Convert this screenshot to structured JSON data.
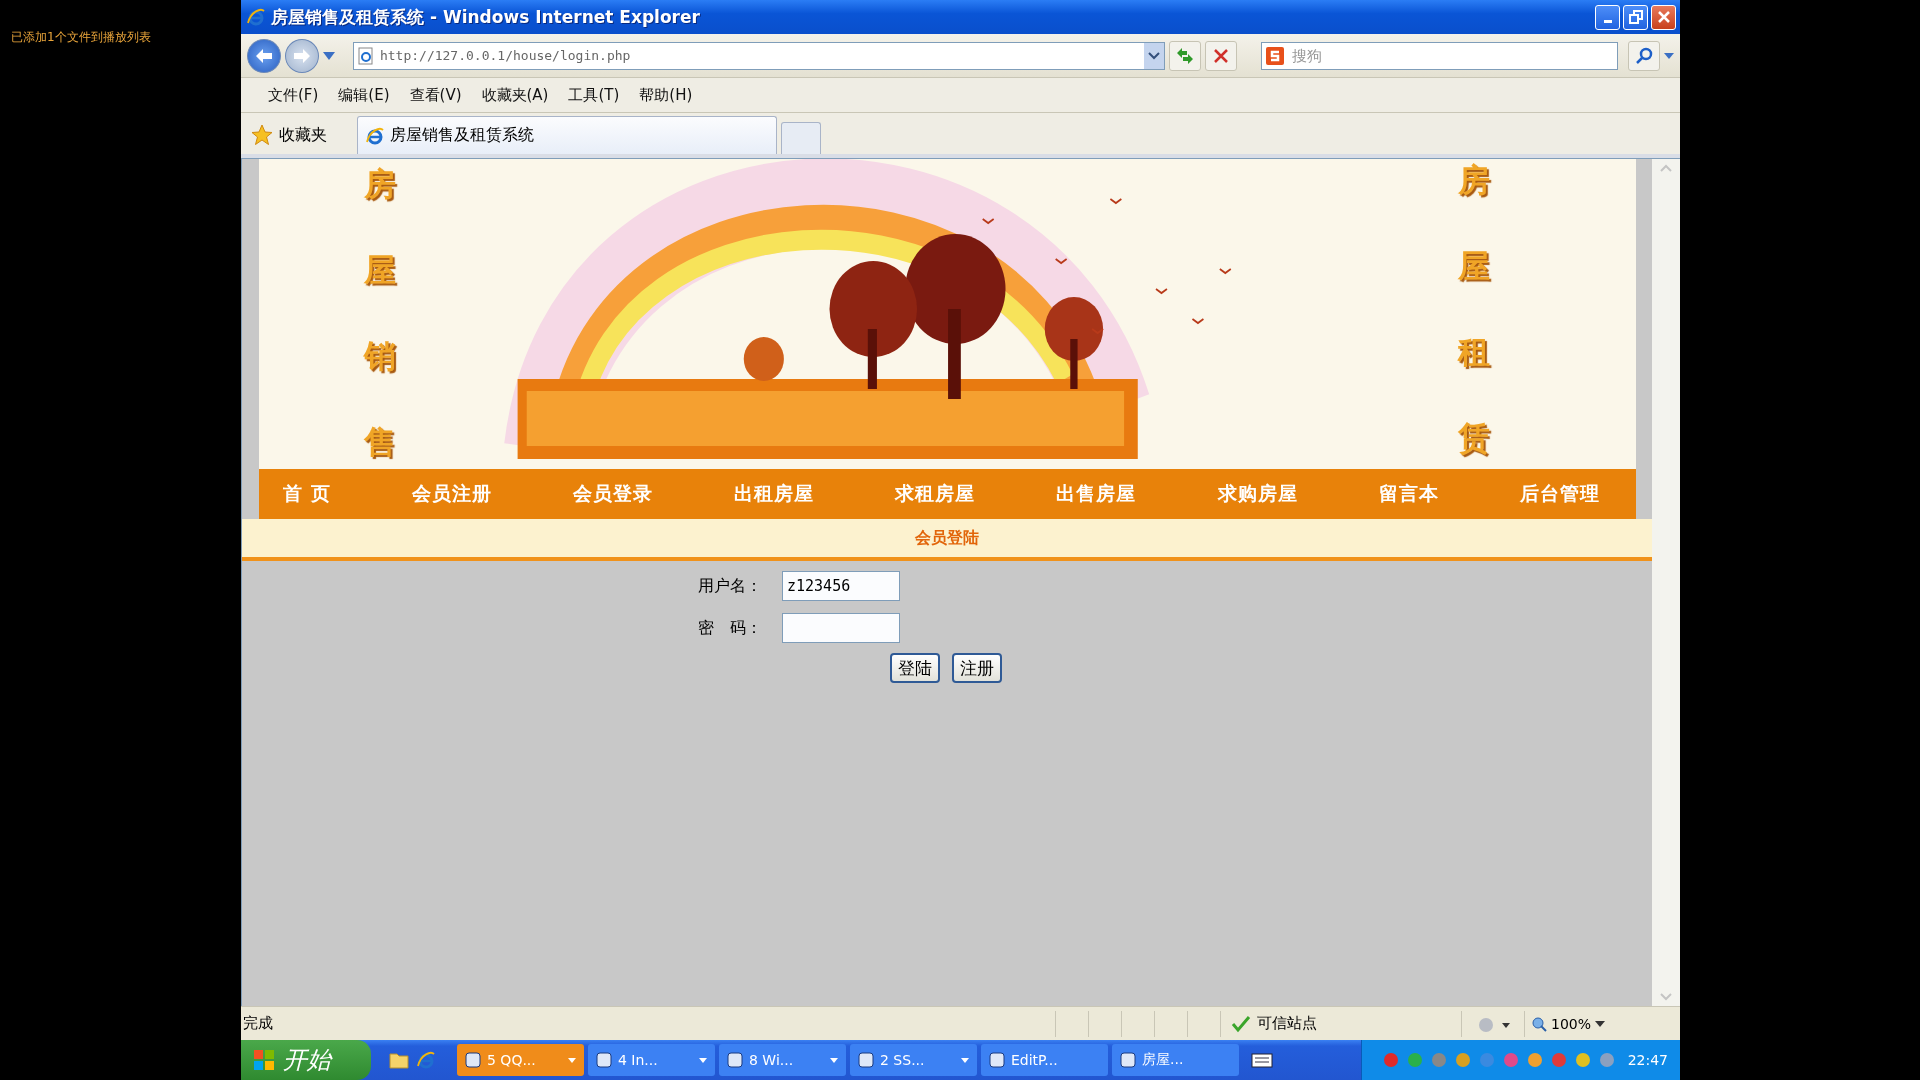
{
  "player_notice": "已添加1个文件到播放列表",
  "window": {
    "title": "房屋销售及租赁系统 - Windows Internet Explorer"
  },
  "address_bar": {
    "url": "http://127.0.0.1/house/login.php"
  },
  "search_box": {
    "placeholder": "搜狗"
  },
  "menu": [
    "文件(F)",
    "编辑(E)",
    "查看(V)",
    "收藏夹(A)",
    "工具(T)",
    "帮助(H)"
  ],
  "favorites": {
    "label": "收藏夹"
  },
  "tabs": [
    {
      "label": "房屋销售及租赁系统",
      "selected": true
    }
  ],
  "banner": {
    "left_caption": "房屋销售",
    "right_caption": "房屋租赁"
  },
  "nav": [
    "首 页",
    "会员注册",
    "会员登录",
    "出租房屋",
    "求租房屋",
    "出售房屋",
    "求购房屋",
    "留言本",
    "后台管理"
  ],
  "section_title": "会员登陆",
  "form": {
    "fields": [
      {
        "label": "用户名：",
        "kind": "text",
        "value": "z123456"
      },
      {
        "label": "密　码：",
        "kind": "password"
      }
    ],
    "buttons": [
      "登陆",
      "注册"
    ]
  },
  "status_bar": {
    "text": "完成",
    "zone": "可信站点",
    "zoom": "100%"
  },
  "taskbar": {
    "start": "开始",
    "tasks": [
      {
        "label": "5 QQ...",
        "grouped": true,
        "flashing": true
      },
      {
        "label": "4 In...",
        "grouped": true,
        "flashing": false
      },
      {
        "label": "8 Wi...",
        "grouped": true,
        "flashing": false
      },
      {
        "label": "2 SS...",
        "grouped": true,
        "flashing": false
      },
      {
        "label": "EditP...",
        "grouped": false,
        "flashing": false
      },
      {
        "label": "房屋...",
        "grouped": false,
        "flashing": false
      }
    ],
    "clock": "22:47"
  }
}
